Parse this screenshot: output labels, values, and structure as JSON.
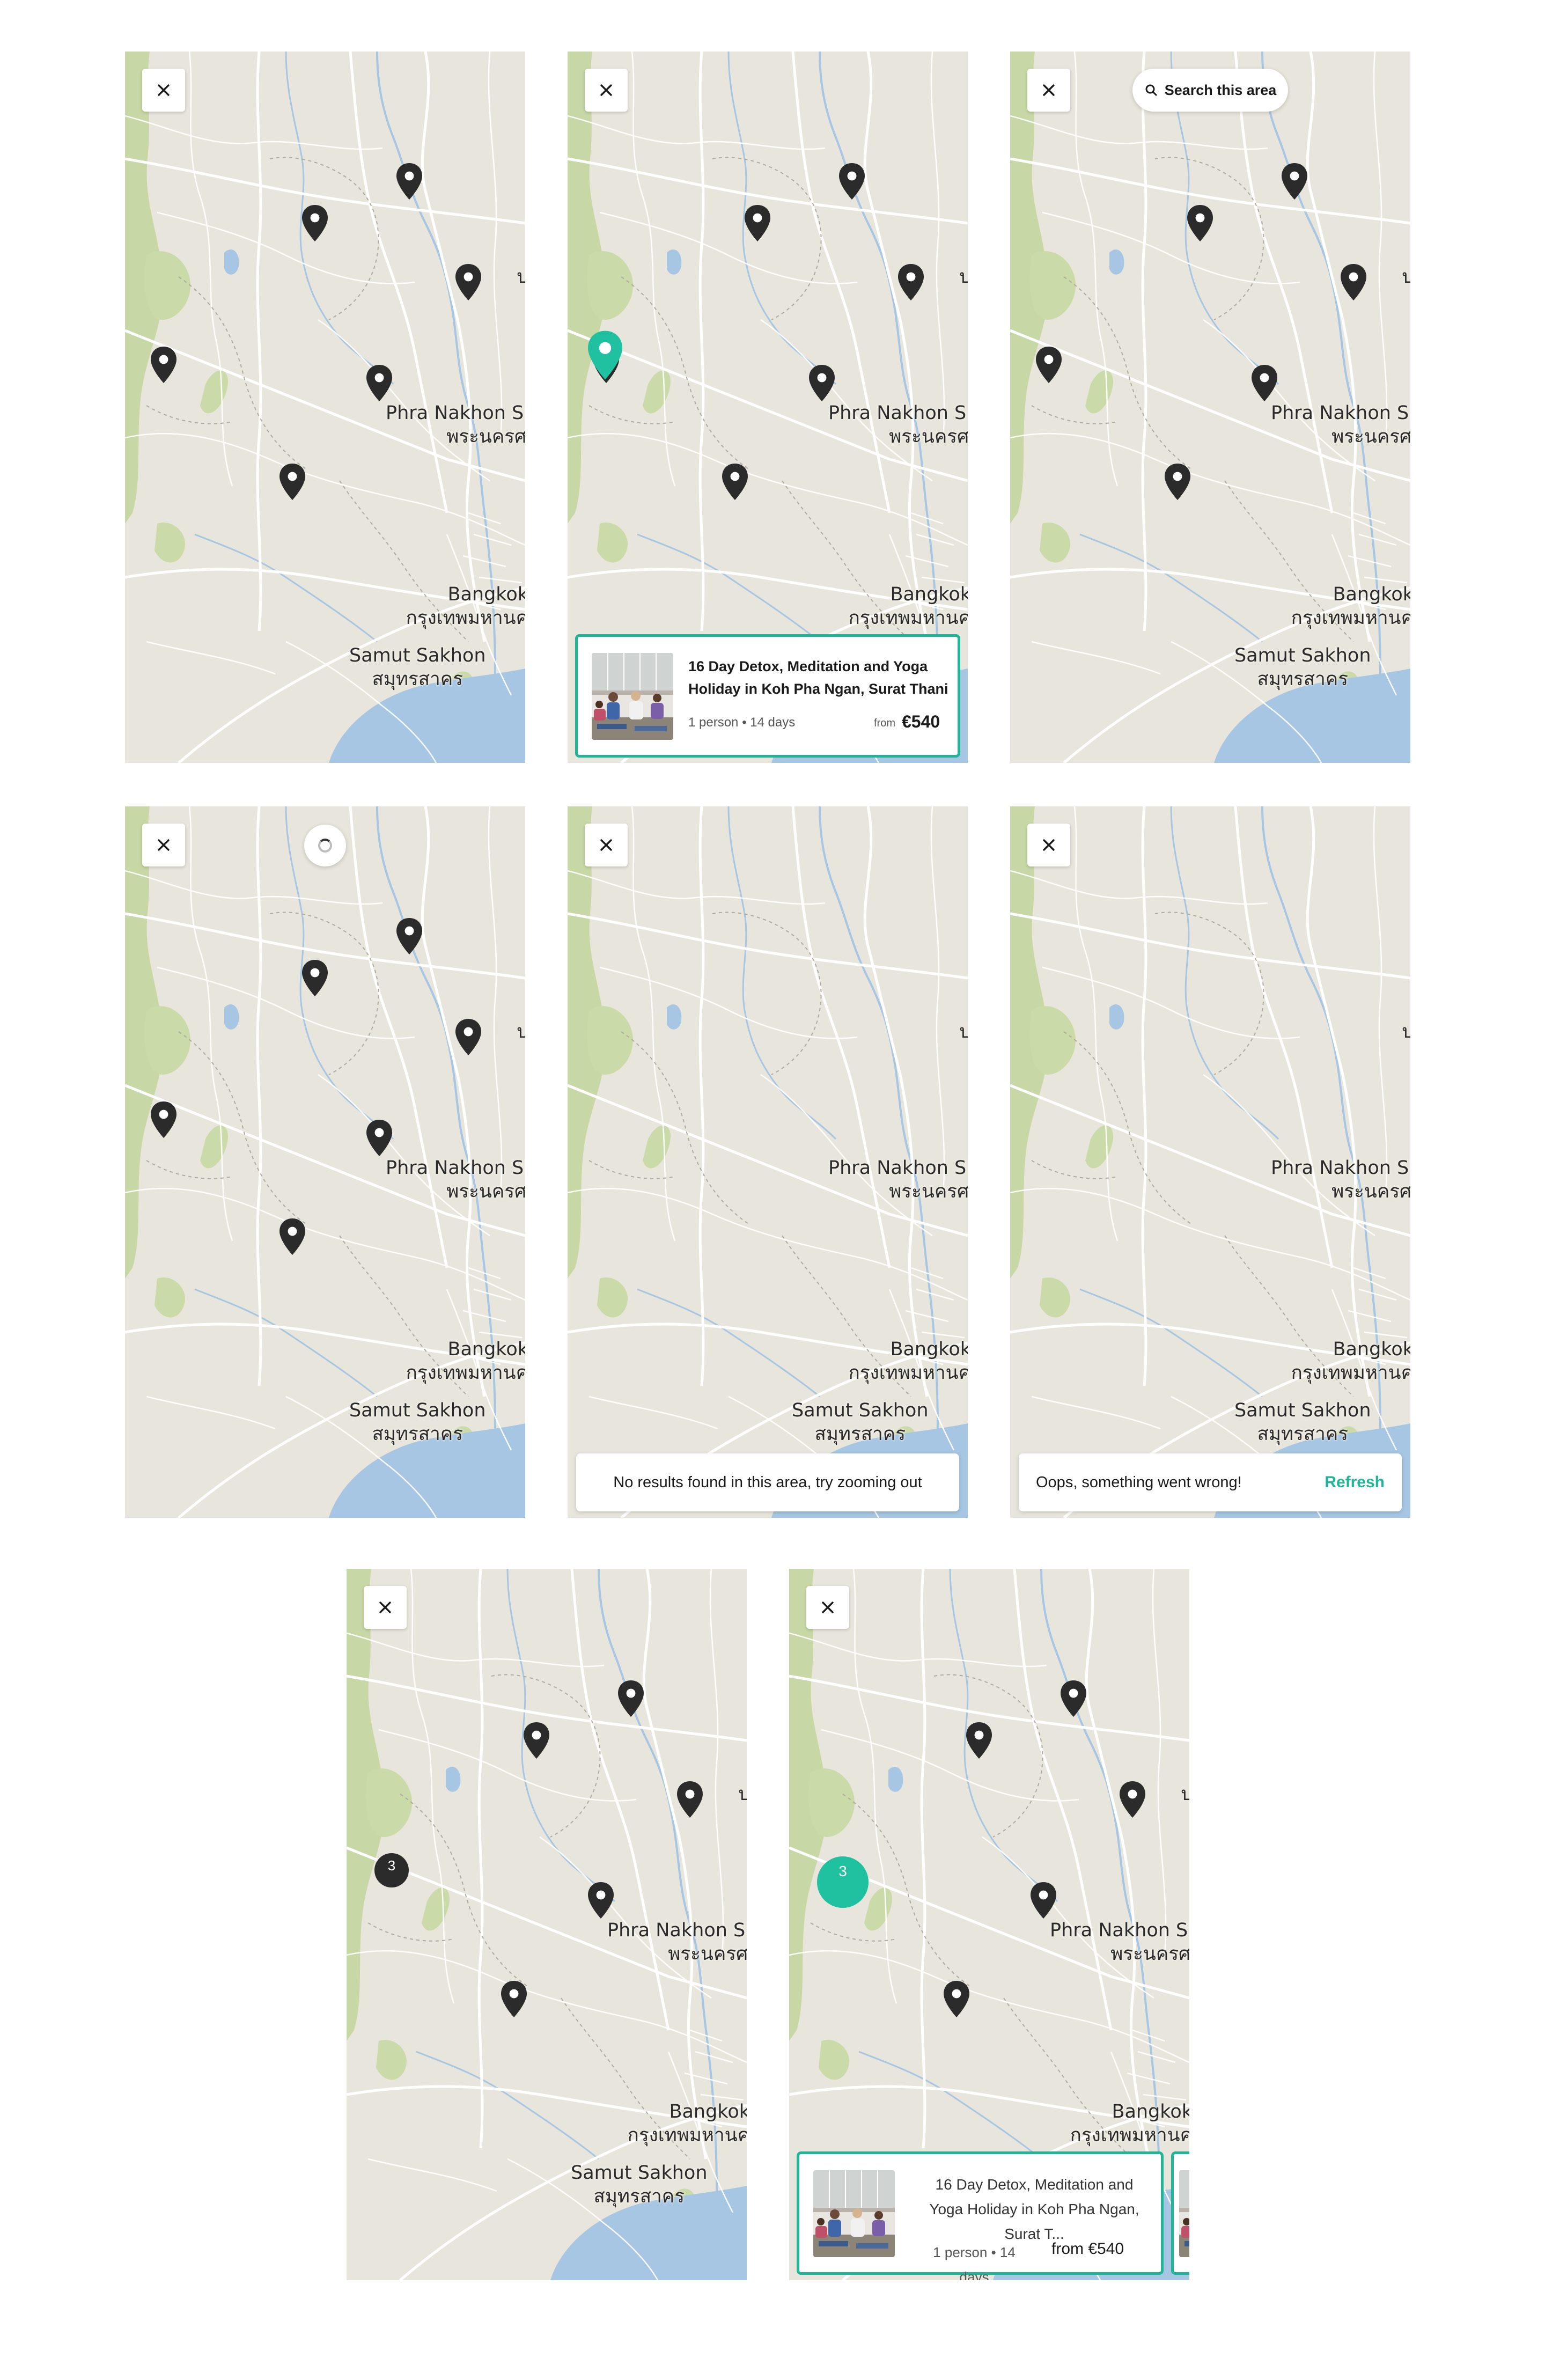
{
  "map_labels": {
    "phra_nakhon": "Phra Nakhon Si A",
    "phra_nakhon_thai": "พระนครศรีอ",
    "bangkok": "Bangkok",
    "bangkok_thai": "กรุงเทพมหานค",
    "samut_sakhon": "Samut Sakhon",
    "samut_sakhon_thai": "สมุทรสาคร",
    "edge_label": "ป"
  },
  "search_area": {
    "label": "Search this area"
  },
  "card_full": {
    "title_line1": "16 Day Detox, Meditation and Yoga",
    "title_line2": "Holiday in Koh Pha Ngan, Surat Thani",
    "meta": "1 person • 14 days",
    "from": "from",
    "price": "€540"
  },
  "card_compact": {
    "title_line1": "16 Day Detox, Meditation and",
    "title_line2": "Yoga Holiday in Koh Pha Ngan,",
    "title_line3": "Surat T...",
    "meta_line1": "1 person • 14",
    "meta_line2": "days",
    "from_price": "from €540"
  },
  "cluster_count": "3",
  "toasts": {
    "no_results": "No results found in this area, try zooming out",
    "error": "Oops, something went wrong!",
    "refresh": "Refresh"
  },
  "icons": {
    "close": "close-icon",
    "search": "search-icon",
    "pin": "map-pin-icon",
    "spinner": "loading-spinner-icon"
  },
  "colors": {
    "accent": "#1fb596",
    "pin_dark": "#2b2b2b",
    "map_land": "#e8e6dc",
    "water": "#a6c6e3",
    "park": "#c6d6a2"
  }
}
